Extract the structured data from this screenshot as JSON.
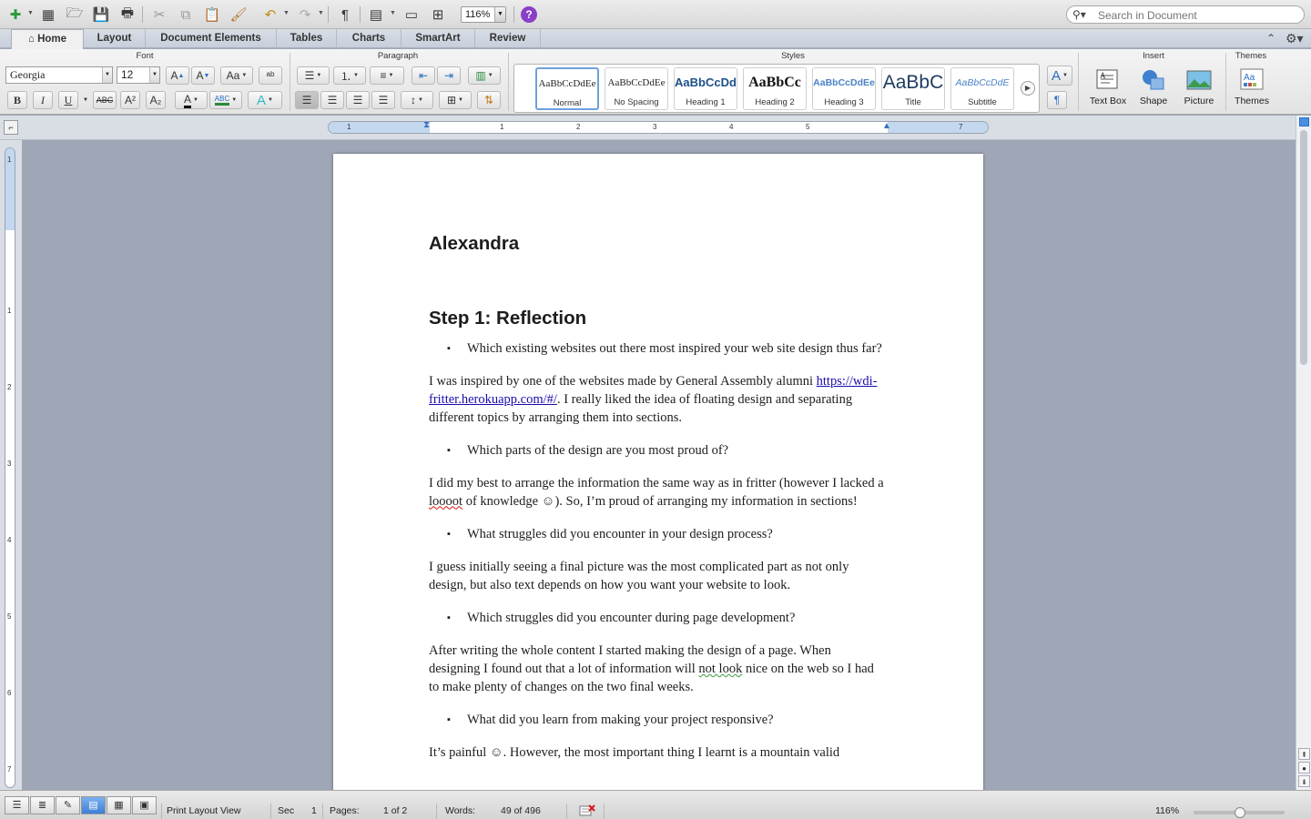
{
  "toolbar": {
    "zoom": "116%",
    "help": "?",
    "search_placeholder": "Search in Document",
    "pilcrow": "¶"
  },
  "ribbon_tabs": [
    "Home",
    "Layout",
    "Document Elements",
    "Tables",
    "Charts",
    "SmartArt",
    "Review"
  ],
  "ribbon": {
    "groups": {
      "font": "Font",
      "paragraph": "Paragraph",
      "styles": "Styles",
      "insert": "Insert",
      "themes": "Themes"
    },
    "font_name": "Georgia",
    "font_size": "12",
    "format_buttons": {
      "bold": "B",
      "italic": "I",
      "underline": "U",
      "strike": "ABC",
      "superscript": "A²",
      "subscript": "A₂",
      "font_color": "A",
      "grow": "A",
      "shrink": "A",
      "change_case": "Aa"
    },
    "styles": [
      {
        "sample": "AaBbCcDdEe",
        "name": "Normal"
      },
      {
        "sample": "AaBbCcDdEe",
        "name": "No Spacing"
      },
      {
        "sample": "AaBbCcDd",
        "name": "Heading 1"
      },
      {
        "sample": "AaBbCc",
        "name": "Heading 2"
      },
      {
        "sample": "AaBbCcDdEe",
        "name": "Heading 3"
      },
      {
        "sample": "AaBbC",
        "name": "Title"
      },
      {
        "sample": "AaBbCcDdE",
        "name": "Subtitle"
      }
    ],
    "insert_buttons": [
      "Text Box",
      "Shape",
      "Picture"
    ],
    "themes_button": "Themes"
  },
  "ruler": {
    "h_numbers": [
      "1",
      "1",
      "2",
      "3",
      "4",
      "5",
      "7"
    ],
    "v_numbers": [
      "1",
      "1",
      "2",
      "3",
      "4",
      "5",
      "6",
      "7"
    ]
  },
  "document": {
    "title": "Alexandra",
    "heading": "Step 1: Reflection",
    "q1": "Which existing websites out there most inspired your web site design thus far?",
    "a1_before": "I was inspired by one of the websites made by General Assembly alumni ",
    "a1_link": "https://wdi-fritter.herokuapp.com/#/",
    "a1_after": ". I really liked the idea of floating design and separating different topics by arranging them into sections.",
    "q2": "Which parts of the design are you most proud of?",
    "a2_before": "I did my best to arrange the information the same way as in fritter (however I lacked a ",
    "a2_squig": "loooot",
    "a2_after": " of knowledge ☺). So, I’m proud of arranging my information in sections!",
    "q3": "What struggles did you encounter in your design process?",
    "a3": "I guess initially seeing a final picture was the most complicated part as not only design, but also text depends on how you want your website to look.",
    "q4": "Which struggles did you encounter during page development?",
    "a4_before": "After writing the whole content I started making the design of a page. When designing I found out that a lot of information will ",
    "a4_squig": "not  look",
    "a4_after": " nice on the web so I had to make plenty of changes on the two final weeks.",
    "q5": "What did you learn from making your project responsive?",
    "a5_partial": "It’s painful ☺. However, the most important thing I learnt is a mountain valid"
  },
  "statusbar": {
    "view_name": "Print Layout View",
    "sec_label": "Sec",
    "sec_value": "1",
    "pages_label": "Pages:",
    "pages_value": "1 of 2",
    "words_label": "Words:",
    "words_value": "49 of 496",
    "zoom": "116%"
  },
  "colors": {
    "accent": "#3d7fd6",
    "link": "#1a0dab",
    "spelling_error": "#d11111",
    "grammar_error": "#3a9a3a",
    "help": "#8a3fc7"
  }
}
